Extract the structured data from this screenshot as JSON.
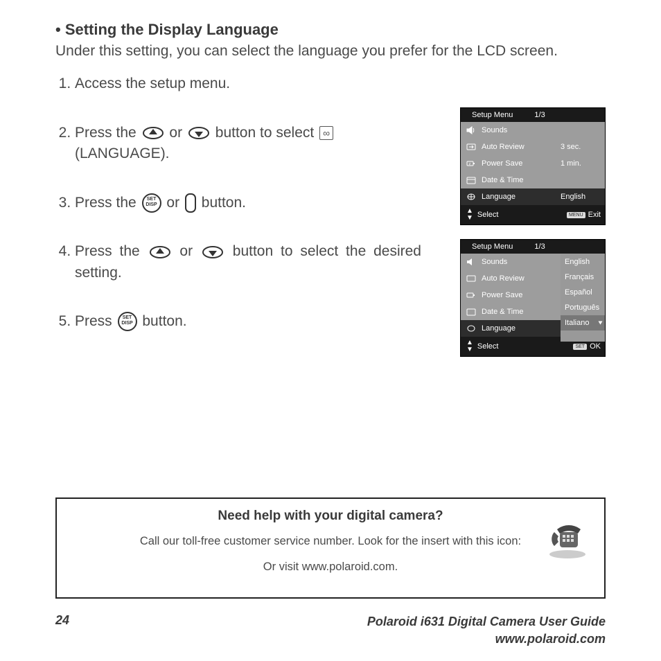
{
  "section": {
    "title": "• Setting the Display Language",
    "intro": "Under this setting, you can select the language you prefer for the LCD screen."
  },
  "steps": {
    "s1": "Access the setup menu.",
    "s2a": "Press the",
    "s2b": "or",
    "s2c": "button to select",
    "s2d": "(LANGUAGE).",
    "s3a": "Press the",
    "s3b": "or",
    "s3c": "button.",
    "s4a": "Press the",
    "s4b": "or",
    "s4c": "button to select the desired setting.",
    "s5a": "Press",
    "s5b": "button.",
    "setdisp": "SET\nDISP",
    "langglyph": "∞"
  },
  "menu1": {
    "title": "Setup Menu",
    "page": "1/3",
    "rows": [
      {
        "icon": "speaker-icon",
        "label": "Sounds",
        "val": ""
      },
      {
        "icon": "review-icon",
        "label": "Auto Review",
        "val": "3 sec."
      },
      {
        "icon": "power-icon",
        "label": "Power Save",
        "val": "1 min."
      },
      {
        "icon": "clock-icon",
        "label": "Date & Time",
        "val": ""
      },
      {
        "icon": "lang-icon",
        "label": "Language",
        "val": "English"
      }
    ],
    "foot_select": "Select",
    "foot_btn": "MENU",
    "foot_action": "Exit"
  },
  "menu2": {
    "title": "Setup Menu",
    "page": "1/3",
    "rows": [
      {
        "icon": "speaker-icon",
        "label": "Sounds"
      },
      {
        "icon": "review-icon",
        "label": "Auto Review"
      },
      {
        "icon": "power-icon",
        "label": "Power Save"
      },
      {
        "icon": "clock-icon",
        "label": "Date & Time"
      },
      {
        "icon": "lang-icon",
        "label": "Language"
      }
    ],
    "options": [
      "English",
      "Français",
      "Español",
      "Português",
      "Italiano"
    ],
    "foot_select": "Select",
    "foot_btn": "SET",
    "foot_action": "OK"
  },
  "help": {
    "title": "Need help with your digital camera?",
    "line1": "Call our toll-free customer service number. Look for the insert with this icon:",
    "line2": "Or visit www.polaroid.com."
  },
  "footer": {
    "page": "24",
    "title": "Polaroid i631 Digital Camera User Guide",
    "url": "www.polaroid.com"
  }
}
